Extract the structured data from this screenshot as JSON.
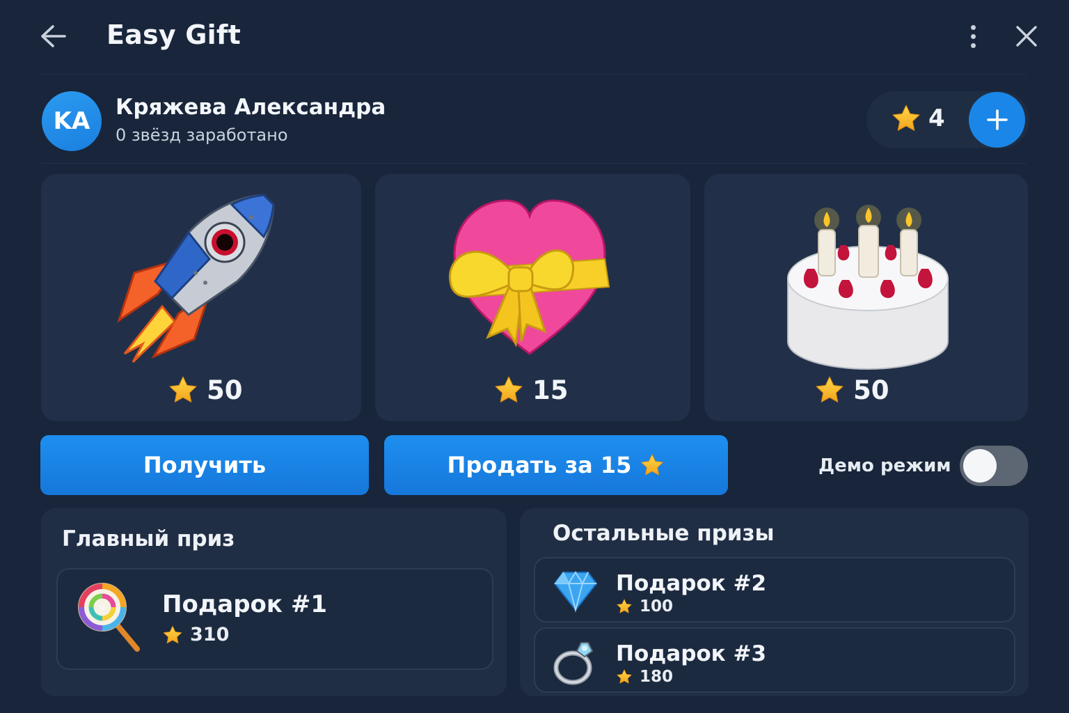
{
  "header": {
    "title": "Easy Gift",
    "back_icon": "arrow-left-icon",
    "menu_icon": "kebab-menu-icon",
    "close_icon": "close-icon"
  },
  "user": {
    "initials": "KA",
    "name": "Кряжева Александра",
    "subtitle": "0 звёзд заработано",
    "balance": "4",
    "add_icon": "plus-icon"
  },
  "gifts": [
    {
      "icon": "rocket-icon",
      "price": "50"
    },
    {
      "icon": "heart-with-ribbon-icon",
      "price": "15"
    },
    {
      "icon": "birthday-cake-icon",
      "price": "50"
    }
  ],
  "actions": {
    "get_label": "Получить",
    "sell_label": "Продать за 15",
    "demo_label": "Демо режим",
    "demo_enabled": false
  },
  "main_prize": {
    "title": "Главный приз",
    "name": "Подарок #1",
    "price": "310",
    "icon": "lollipop-icon"
  },
  "other_prizes": {
    "title": "Остальные призы",
    "items": [
      {
        "name": "Подарок #2",
        "price": "100",
        "icon": "gem-icon"
      },
      {
        "name": "Подарок #3",
        "price": "180",
        "icon": "ring-icon"
      }
    ]
  },
  "colors": {
    "background": "#18253a",
    "card": "#213048",
    "accent": "#1a86e8",
    "star": "#f6b928"
  }
}
